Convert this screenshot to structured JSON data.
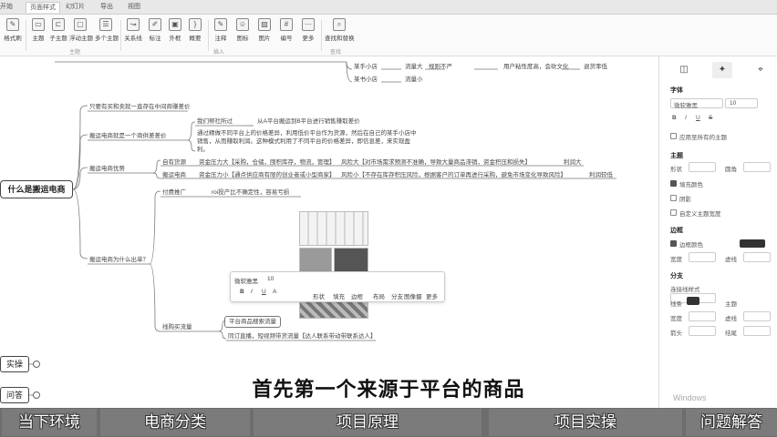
{
  "titlebar": {
    "tabs": [
      "开始",
      "页面样式",
      "幻灯片",
      "导出",
      "视图"
    ]
  },
  "ribbon": {
    "tools": [
      {
        "label": "格式刷",
        "icon": "format-painter-icon"
      },
      {
        "label": "主题",
        "icon": "theme-icon"
      },
      {
        "label": "子主题",
        "icon": "subtopic-icon"
      },
      {
        "label": "浮动主题",
        "icon": "floating-topic-icon"
      },
      {
        "label": "多个主题",
        "icon": "multi-topic-icon"
      },
      {
        "label": "关系线",
        "icon": "relation-line-icon"
      },
      {
        "label": "标注",
        "icon": "callout-icon"
      },
      {
        "label": "外框",
        "icon": "boundary-icon"
      },
      {
        "label": "概要",
        "icon": "summary-icon"
      },
      {
        "label": "注释",
        "icon": "note-icon"
      },
      {
        "label": "图标",
        "icon": "sticker-icon"
      },
      {
        "label": "图片",
        "icon": "image-icon"
      },
      {
        "label": "编号",
        "icon": "numbering-icon"
      },
      {
        "label": "更多",
        "icon": "more-icon"
      },
      {
        "label": "查找和替换",
        "icon": "find-replace-icon"
      }
    ],
    "groups": {
      "topic": "主题",
      "insert": "插入",
      "find": "查找"
    }
  },
  "mindmap": {
    "root": "什么是搬运电商",
    "side_nodes": [
      "实操",
      "问答"
    ],
    "nodes": {
      "n_top_a": "某手小店",
      "n_top_a2": "流量大",
      "n_top_a3": "规则不严",
      "n_top_a4": "用户粘性度高，会砍文化",
      "n_top_a5": "退货率低",
      "n_top_b": "某书小店",
      "n_top_b2": "流量小",
      "b1": "只要有买和卖就一直存在中间商赚差价",
      "b2": "搬运电商就是一个商供差差价",
      "b2a": "我们帮社所过",
      "b2b": "从A平台搬运到B平台进行销售赚取差价",
      "b2c1": "通过精做不同平台上的价格差异，利用低价平台作为货源，然后在自己的某手小店中",
      "b2c2": "销售，从而赚取利润。这种模式利用了不同平台的价格差异，即信息差，来实现盈",
      "b2c3": "利。",
      "b3": "搬运电商优势",
      "b3a": "自有货源",
      "b3a2": "资金压力大【采购，仓储，囤积库存，物流，管理】",
      "b3a3": "风险大【对市场需求预测不准确，导致大量商品滞销，资金积压和损失】",
      "b3a4": "利润大",
      "b3b": "搬运电商",
      "b3b2": "资金压力小【通点供应商有限的创业者或小型商家】",
      "b3b3": "风险小【不存在库存积压风险，根据客户的订单再进行采购，避免市场变化导致风险】",
      "b3b4": "利润较低",
      "b4": "搬运电商为什么出单？",
      "b4a": "付费推广",
      "b4a2": "roi投产比不确定性，容易亏损",
      "b4b": "线购买流量",
      "b4b2": "平台商品搜索流量",
      "b4b3": "同订直播，短视频带货流量【达人联系带动带联系达人】"
    }
  },
  "floatbar": {
    "font": "微软雅黑",
    "size": "10",
    "items": [
      "B",
      "I",
      "U",
      "A",
      "形状",
      "填充",
      "边框",
      "布局",
      "分支",
      "图像摄",
      "更多"
    ]
  },
  "right_panel": {
    "section_font": "字体",
    "font_name": "微软雅黑",
    "font_size": "10",
    "chk_apply": "应用至所有的主题",
    "section_topic": "主题",
    "shape_label": "形状",
    "border_label": "圆角",
    "fill_label": "填充颜色",
    "shadow_label": "阴影",
    "custom_width": "自定义主题宽度",
    "section_border": "边框",
    "border_color": "边框颜色",
    "line_w": "宽度",
    "line_style": "虚线",
    "section_branch": "分支",
    "branch_style": "连接线样式",
    "line_label": "线条",
    "theme_lbl": "主题",
    "width_lbl": "宽度",
    "dashed_lbl": "虚线",
    "arrow_lbl": "箭头",
    "end_lbl": "结尾"
  },
  "subtitle": "首先第一个来源于平台的商品",
  "watermark": "Windows",
  "bottom_nav": [
    "当下环境",
    "电商分类",
    "项目原理",
    "项目实操",
    "问题解答"
  ],
  "colors": {
    "bottom_bar": "#6d6d6d",
    "bottom_tab": "#7b7b7b"
  }
}
